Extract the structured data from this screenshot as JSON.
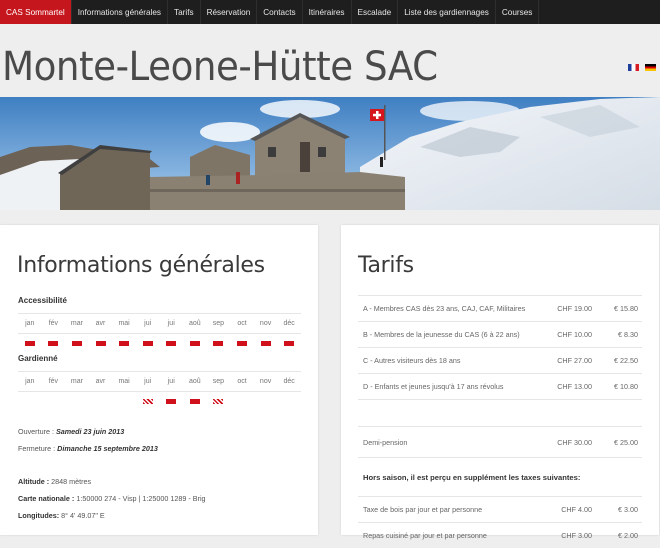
{
  "nav": {
    "items": [
      "CAS Sommartel",
      "Informations générales",
      "Tarifs",
      "Réservation",
      "Contacts",
      "Itinéraires",
      "Escalade",
      "Liste des gardiennages",
      "Courses"
    ],
    "active_index": 0,
    "active_color": "#c5161d"
  },
  "site": {
    "title": "Monte-Leone-Hütte SAC"
  },
  "languages": [
    "fr",
    "de"
  ],
  "info": {
    "title": "Informations générales",
    "accessibility_label": "Accessibilité",
    "guarded_label": "Gardienné",
    "months": [
      "jan",
      "fév",
      "mar",
      "avr",
      "mai",
      "jui",
      "jui",
      "aoû",
      "sep",
      "oct",
      "nov",
      "déc"
    ],
    "accessibility_marks": [
      "full",
      "full",
      "full",
      "full",
      "full",
      "full",
      "full",
      "full",
      "full",
      "full",
      "full",
      "full"
    ],
    "guarded_marks": [
      "none",
      "none",
      "none",
      "none",
      "none",
      "partial",
      "full",
      "full",
      "partial",
      "none",
      "none",
      "none"
    ],
    "opening_label": "Ouverture :",
    "opening_value": "Samedi 23 juin 2013",
    "closing_label": "Fermeture :",
    "closing_value": "Dimanche 15 septembre 2013",
    "altitude_label": "Altitude :",
    "altitude_value": "2848 mètres",
    "map_label": "Carte nationale :",
    "map_value": "1:50000 274 - Visp | 1:25000 1289 - Brig",
    "longitude_label": "Longitudes:",
    "longitude_value": "8° 4' 49.07\" E"
  },
  "tarifs": {
    "title": "Tarifs",
    "rows": [
      {
        "label": "A - Membres CAS dès 23 ans, CAJ, CAF, Militaires",
        "chf": "CHF 19.00",
        "eur": "€ 15.80"
      },
      {
        "label": "B - Membres de la jeunesse du CAS (6 à 22 ans)",
        "chf": "CHF 10.00",
        "eur": "€ 8.30"
      },
      {
        "label": "C - Autres visiteurs dès 18 ans",
        "chf": "CHF 27.00",
        "eur": "€ 22.50"
      },
      {
        "label": "D - Enfants et jeunes jusqu'à 17 ans révolus",
        "chf": "CHF 13.00",
        "eur": "€ 10.80"
      },
      {
        "label": "",
        "chf": "",
        "eur": ""
      },
      {
        "label": "Demi-pension",
        "chf": "CHF 30.00",
        "eur": "€ 25.00"
      }
    ],
    "season_note": "Hors saison, il est perçu en supplément les taxes suivantes:",
    "extra_rows": [
      {
        "label": "Taxe de bois par jour et par personne",
        "chf": "CHF 4.00",
        "eur": "€ 3.00"
      },
      {
        "label": "Repas cuisiné par jour et par personne",
        "chf": "CHF 3.00",
        "eur": "€ 2.00"
      }
    ]
  }
}
